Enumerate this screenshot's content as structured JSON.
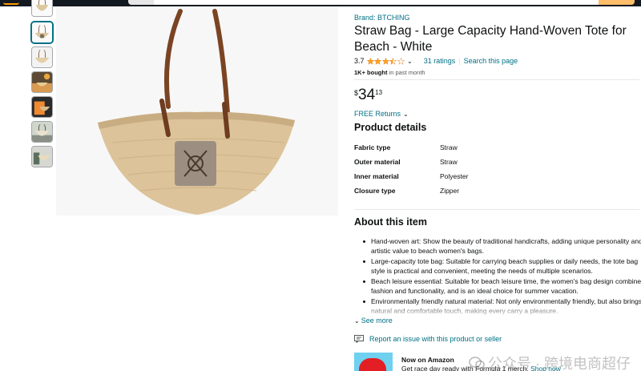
{
  "header": {
    "logo_icon": "amazon-logo-icon",
    "search_placeholder": ""
  },
  "gallery": {
    "thumbnail_count": 7,
    "selected_index": 1,
    "main_image_icon": "straw-tote-bag-image"
  },
  "product": {
    "brand": "Brand: BTCHING",
    "title": "Straw Bag - Large Capacity Hand-Woven Tote for Beach - White",
    "rating_value": "3.7",
    "rating_stars": 3.7,
    "ratings_count": "31 ratings",
    "search_link": "Search this page",
    "bought_bold": "1K+ bought",
    "bought_rest": " in past month",
    "price_symbol": "$",
    "price_whole": "34",
    "price_fraction": "13",
    "free_returns": "FREE Returns"
  },
  "details": {
    "heading": "Product details",
    "rows": [
      {
        "label": "Fabric type",
        "value": "Straw"
      },
      {
        "label": "Outer material",
        "value": "Straw"
      },
      {
        "label": "Inner material",
        "value": "Polyester"
      },
      {
        "label": "Closure type",
        "value": "Zipper"
      }
    ]
  },
  "about": {
    "heading": "About this item",
    "bullets": [
      "Hand-woven art: Show the beauty of traditional handicrafts, adding unique personality and artistic value to beach women's bags.",
      "Large-capacity tote bag: Suitable for carrying beach supplies or daily needs, the tote bag style is practical and convenient, meeting the needs of multiple scenarios.",
      "Beach leisure essential: Suitable for beach leisure time, the women's bag design combines fashion and functionality, and is an ideal choice for summer vacation.",
      "Environmentally friendly natural material: Not only environmentally friendly, but also brings a natural and comfortable touch, making every carry a pleasure."
    ],
    "see_more": "See more"
  },
  "report": {
    "label": "Report an issue with this product or seller"
  },
  "promo": {
    "title": "Now on Amazon",
    "text": "Get race day ready with Formula 1 merch. ",
    "link": "Shop now"
  },
  "watermark": {
    "text": "公众号 · 跨境电商超仔"
  },
  "colors": {
    "link": "#007185",
    "star": "#ffa41c",
    "header": "#131921"
  }
}
